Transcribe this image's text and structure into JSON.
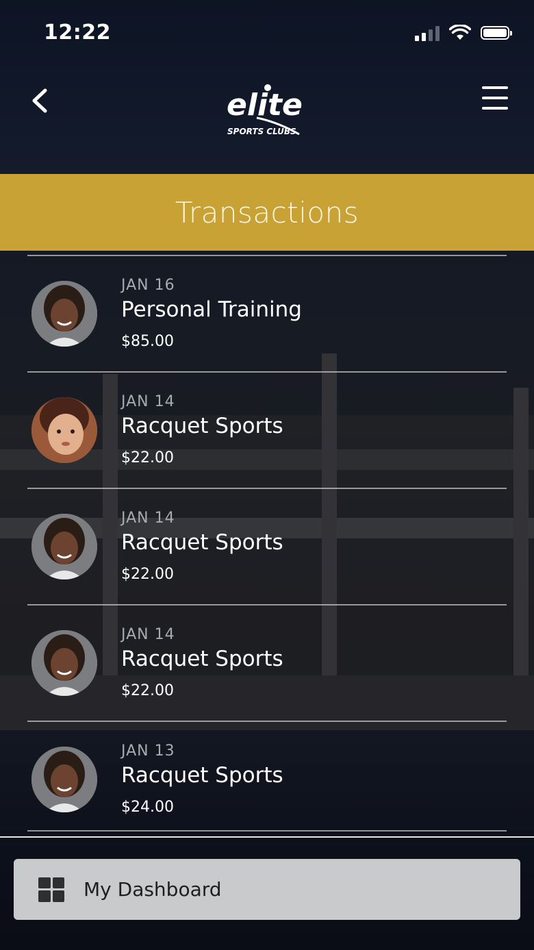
{
  "status_bar": {
    "time": "12:22"
  },
  "header": {
    "logo_main": "elite",
    "logo_sub": "SPORTS CLUBS",
    "back_icon": "chevron-left-icon",
    "menu_icon": "hamburger-menu-icon"
  },
  "banner": {
    "title": "Transactions"
  },
  "transactions": [
    {
      "date": "JAN 16",
      "name": "Personal Training",
      "amount": "$85.00"
    },
    {
      "date": "JAN 14",
      "name": "Racquet Sports",
      "amount": "$22.00"
    },
    {
      "date": "JAN 14",
      "name": "Racquet Sports",
      "amount": "$22.00"
    },
    {
      "date": "JAN 14",
      "name": "Racquet Sports",
      "amount": "$22.00"
    },
    {
      "date": "JAN 13",
      "name": "Racquet Sports",
      "amount": "$24.00"
    }
  ],
  "dashboard_button": {
    "label": "My Dashboard",
    "icon": "grid-icon"
  },
  "colors": {
    "accent": "#c9a235",
    "header_bg": "#101626"
  }
}
